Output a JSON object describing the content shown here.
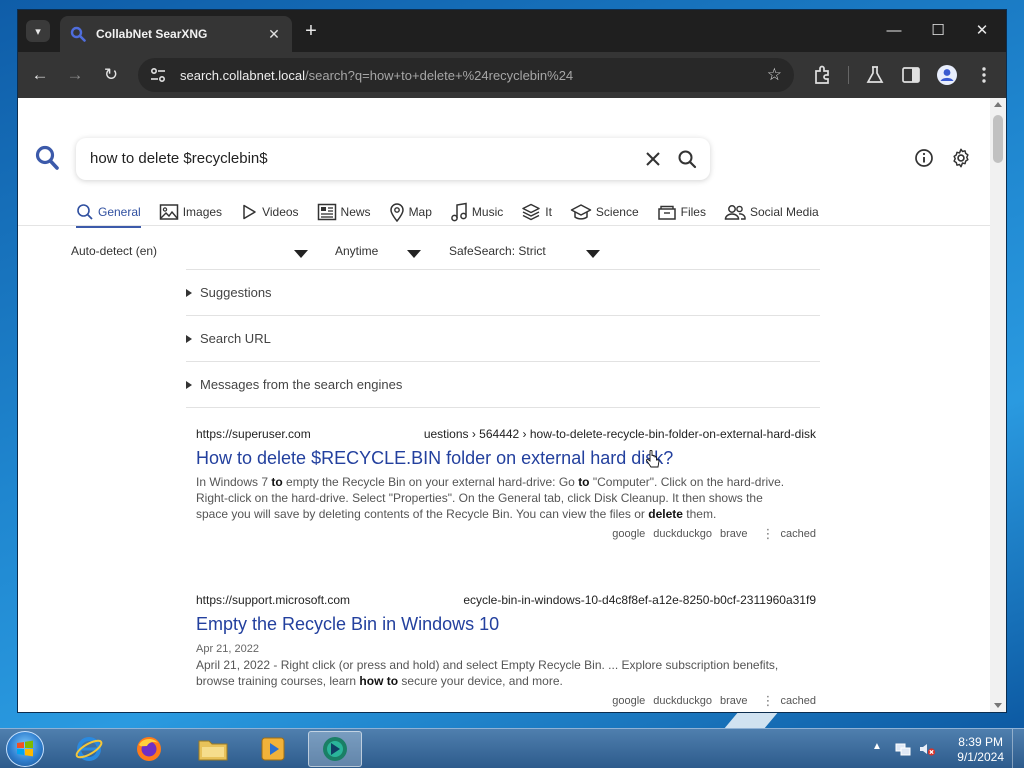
{
  "browser": {
    "tab_title": "CollabNet SearXNG",
    "url_host": "search.collabnet.local",
    "url_rest": "/search?q=how+to+delete+%24recyclebin%24"
  },
  "search": {
    "query": "how to delete $recyclebin$"
  },
  "categories": [
    {
      "label": "General",
      "icon": "search-icon",
      "active": true
    },
    {
      "label": "Images",
      "icon": "image-icon"
    },
    {
      "label": "Videos",
      "icon": "play-icon"
    },
    {
      "label": "News",
      "icon": "newspaper-icon"
    },
    {
      "label": "Map",
      "icon": "map-pin-icon"
    },
    {
      "label": "Music",
      "icon": "music-icon"
    },
    {
      "label": "It",
      "icon": "layers-icon"
    },
    {
      "label": "Science",
      "icon": "school-icon"
    },
    {
      "label": "Files",
      "icon": "files-icon"
    },
    {
      "label": "Social Media",
      "icon": "people-icon"
    }
  ],
  "filters": {
    "language": "Auto-detect (en)",
    "time": "Anytime",
    "safesearch": "SafeSearch: Strict"
  },
  "details": [
    "Suggestions",
    "Search URL",
    "Messages from the search engines"
  ],
  "results": [
    {
      "url_left": "https://superuser.com",
      "url_right": "uestions › 564442 › how-to-delete-recycle-bin-folder-on-external-hard-disk",
      "title": "How to delete $RECYCLE.BIN folder on external hard disk?",
      "date": "",
      "content": [
        {
          "t": "In Windows 7 ",
          "b": false
        },
        {
          "t": "to",
          "b": true
        },
        {
          "t": " empty the Recycle Bin on your external hard-drive: Go ",
          "b": false
        },
        {
          "t": "to",
          "b": true
        },
        {
          "t": " \"Computer\". Click on the hard-drive. Right-click on the hard-drive. Select \"Properties\". On the General tab, click Disk Cleanup. It then shows the space you will save by deleting contents of the Recycle Bin. You can view the files or ",
          "b": false
        },
        {
          "t": "delete",
          "b": true
        },
        {
          "t": " them.",
          "b": false
        }
      ],
      "engines": [
        "google",
        "duckduckgo",
        "brave"
      ],
      "cached": "cached"
    },
    {
      "url_left": "https://support.microsoft.com",
      "url_right": "ecycle-bin-in-windows-10-d4c8f8ef-a12e-8250-b0cf-2311960a31f9",
      "title": "Empty the Recycle Bin in Windows 10",
      "date": "Apr 21, 2022",
      "content": [
        {
          "t": "April 21, 2022 - Right click (or press and hold) and select Empty Recycle Bin. ... Explore subscription benefits, browse training courses, learn ",
          "b": false
        },
        {
          "t": "how to",
          "b": true
        },
        {
          "t": " secure your device, and more.",
          "b": false
        }
      ],
      "engines": [
        "google",
        "duckduckgo",
        "brave"
      ],
      "cached": "cached"
    }
  ],
  "taskbar": {
    "time": "8:39 PM",
    "date": "9/1/2024",
    "apps": [
      "internet-explorer",
      "firefox",
      "file-explorer",
      "media-player",
      "active-app"
    ]
  },
  "colors": {
    "link": "#23409e",
    "accent": "#3c5aaa",
    "chrome_dark": "#1f1f1f"
  }
}
